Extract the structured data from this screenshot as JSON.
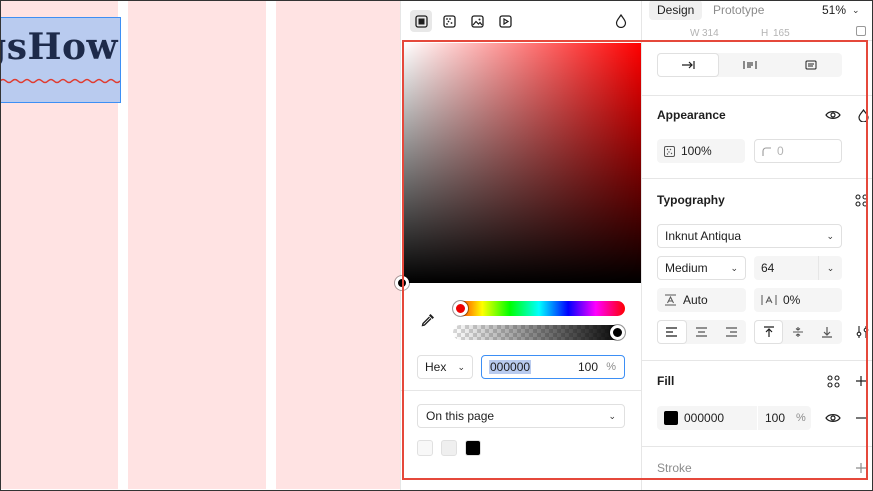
{
  "canvas": {
    "text_frame_text": "gsHow"
  },
  "picker": {
    "tabs": [
      {
        "icon": "custom-color-icon",
        "active": true
      },
      {
        "icon": "gradient-icon",
        "active": false
      },
      {
        "icon": "image-fill-icon",
        "active": false
      },
      {
        "icon": "video-fill-icon",
        "active": false
      }
    ],
    "format": "Hex",
    "hex_value": "000000",
    "alpha_value": "100",
    "alpha_unit": "%",
    "library": "On this page",
    "swatches": [
      "#f8f8f8",
      "#efefef",
      "#000000"
    ],
    "hue": 0,
    "alpha": 1.0
  },
  "panel": {
    "tabs": {
      "design": "Design",
      "prototype": "Prototype"
    },
    "zoom": "51%",
    "cut_w_label": "W",
    "cut_w_value": "314",
    "cut_h_label": "H",
    "cut_h_value": "165",
    "appearance": {
      "title": "Appearance",
      "opacity": "100%",
      "corner_radius_placeholder": "0"
    },
    "typography": {
      "title": "Typography",
      "font_family": "Inknut Antiqua",
      "font_weight": "Medium",
      "font_size": "64",
      "line_height": "Auto",
      "letter_spacing": "0%"
    },
    "fill": {
      "title": "Fill",
      "color_hex": "000000",
      "opacity": "100",
      "unit": "%",
      "swatch_color": "#000000"
    },
    "stroke": {
      "title": "Stroke"
    }
  },
  "colors": {
    "highlight": "#e5483b",
    "selection_blue": "#3d8ff5",
    "canvas_columns": "#ffe3e3"
  }
}
